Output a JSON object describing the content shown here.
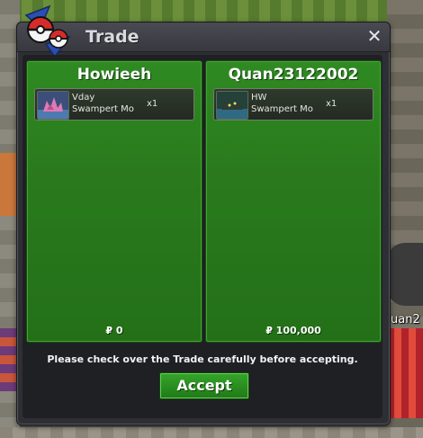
{
  "window": {
    "title": "Trade",
    "close_label": "✕"
  },
  "left_party": {
    "name": "Howieeh",
    "item": {
      "nickname": "Vday",
      "species": "Swampert Mo",
      "quantity": "x1"
    },
    "money": "₽ 0"
  },
  "right_party": {
    "name": "Quan23122002",
    "item": {
      "nickname": "HW",
      "species": "Swampert Mo",
      "quantity": "x1"
    },
    "money": "₽ 100,000"
  },
  "notice": "Please check over the Trade carefully before accepting.",
  "accept_label": "Accept",
  "player_tag": "uan2",
  "icons": {
    "logo": "pokeball-trade-logo-icon",
    "close": "close-icon",
    "left_item": "pokemon-sprite-icon",
    "right_item": "pokemon-sprite-icon"
  },
  "colors": {
    "panel_green": "#2a7a1d",
    "accept_green": "#2a8f22",
    "window_dark": "#2e2e35"
  }
}
